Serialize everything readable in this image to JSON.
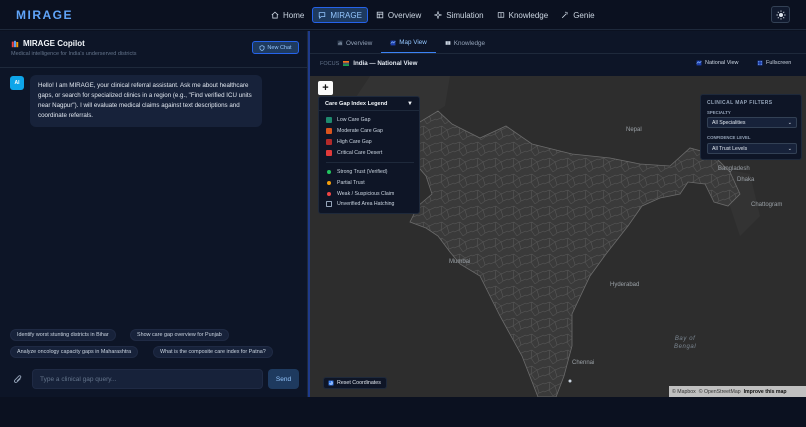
{
  "app": {
    "logo": "MIRAGE",
    "nav": [
      {
        "label": "Home",
        "icon": "home-icon"
      },
      {
        "label": "MIRAGE",
        "icon": "chat-icon",
        "active": true
      },
      {
        "label": "Overview",
        "icon": "grid-icon"
      },
      {
        "label": "Simulation",
        "icon": "spark-icon"
      },
      {
        "label": "Knowledge",
        "icon": "book-icon"
      },
      {
        "label": "Genie",
        "icon": "wand-icon"
      }
    ]
  },
  "copilot": {
    "title": "MIRAGE Copilot",
    "subtitle": "Medical intelligence for India's underserved districts",
    "new_chat": "New Chat",
    "avatar": "AI",
    "message": "Hello! I am MIRAGE, your clinical referral assistant. Ask me about healthcare gaps, or search for specialized clinics in a region (e.g., \"Find verified ICU units near Nagpur\"). I will evaluate medical claims against text descriptions and coordinate referrals.",
    "suggestions": [
      "Identify worst stunting districts in Bihar",
      "Show care gap overview for Punjab",
      "Analyze oncology capacity gaps in Maharashtra",
      "What is the composite care index for Patna?"
    ],
    "input_placeholder": "Type a clinical gap query...",
    "send": "Send"
  },
  "map_panel": {
    "tabs": [
      {
        "label": "Overview",
        "active": false
      },
      {
        "label": "Map View",
        "active": true
      },
      {
        "label": "Knowledge",
        "active": false
      }
    ],
    "focus_label": "FOCUS",
    "focus_value": "India — National View",
    "national_view": "National View",
    "fullscreen": "Fullscreen",
    "zoom_in": "+",
    "legend": {
      "title": "Care Gap Index Legend",
      "items": [
        {
          "label": "Low Care Gap",
          "color": "#1f8a6e"
        },
        {
          "label": "Moderate Care Gap",
          "color": "#d9541e"
        },
        {
          "label": "High Care Gap",
          "color": "#b22a2a"
        },
        {
          "label": "Critical Care Desert",
          "color": "#e03a3a"
        }
      ],
      "trust": [
        {
          "label": "Strong Trust (Verified)",
          "color": "#22c55e"
        },
        {
          "label": "Partial Trust",
          "color": "#f59e0b"
        },
        {
          "label": "Weak / Suspicious Claim",
          "color": "#ef4444"
        },
        {
          "label": "Unverified Area Hatching",
          "color": "hatch"
        }
      ]
    },
    "filters": {
      "title": "CLINICAL MAP FILTERS",
      "specialty_label": "SPECIALTY",
      "specialty_value": "All Specialities",
      "confidence_label": "CONFIDENCE LEVEL",
      "confidence_value": "All Trust Levels"
    },
    "places": {
      "nepal": "Nepal",
      "bangladesh": "Bangladesh",
      "dhaka": "Dhaka",
      "chattogram": "Chattogram",
      "mumbai": "Mumbai",
      "hyderabad": "Hyderabad",
      "bay_line1": "Bay of",
      "bay_line2": "Bengal",
      "chennai": "Chennai"
    },
    "reset": "Reset Coordinates",
    "attribution_a": "© Mapbox",
    "attribution_b": "© OpenStreetMap",
    "attribution_c": "Improve this map"
  }
}
